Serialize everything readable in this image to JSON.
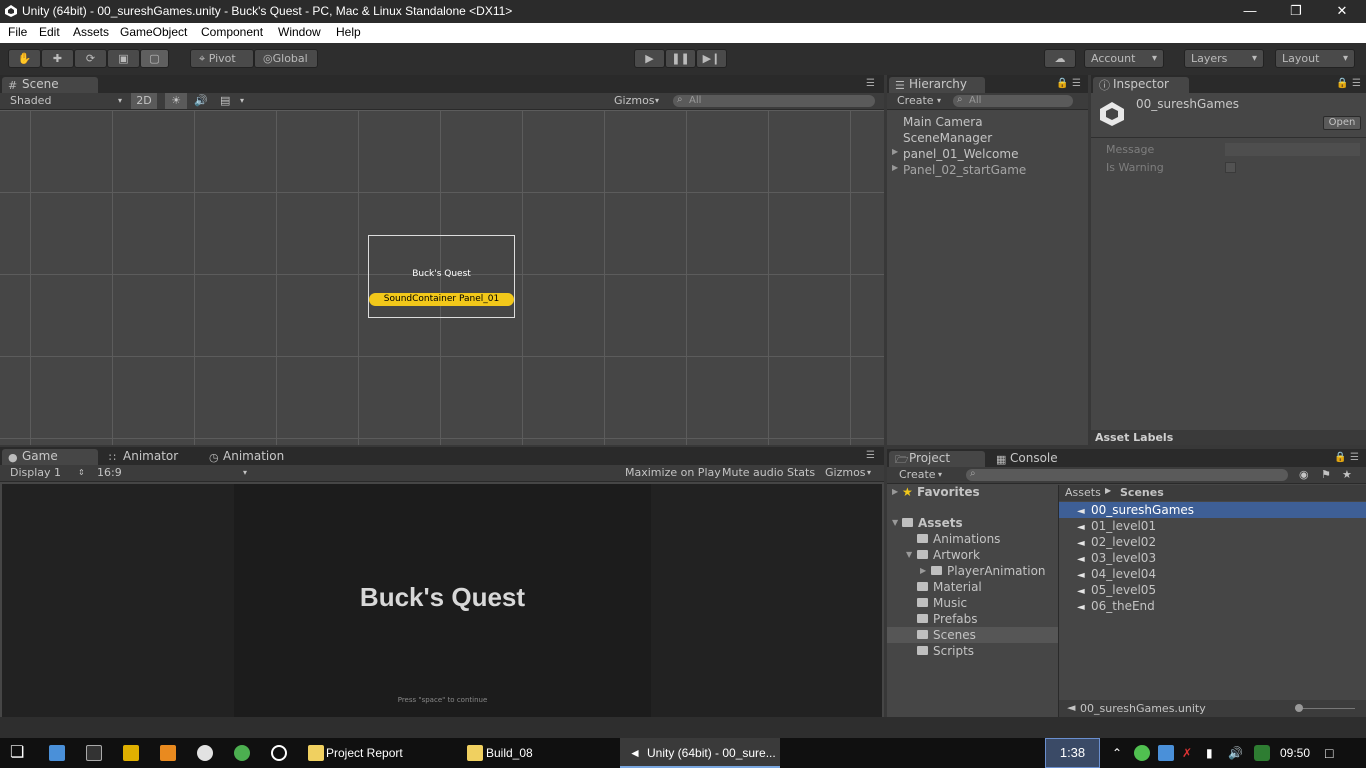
{
  "window": {
    "title": "Unity (64bit) - 00_sureshGames.unity - Buck's Quest - PC, Mac & Linux Standalone <DX11>"
  },
  "menu": [
    "File",
    "Edit",
    "Assets",
    "GameObject",
    "Component",
    "Window",
    "Help"
  ],
  "toolbar": {
    "pivot": "Pivot",
    "global": "Global",
    "account": "Account",
    "layers": "Layers",
    "layout": "Layout"
  },
  "scene": {
    "tab": "Scene",
    "shading": "Shaded",
    "mode2d": "2D",
    "gizmos": "Gizmos",
    "search_placeholder": "All",
    "canvas_title": "Buck's Quest",
    "selected_label": "SoundContainer Panel_01"
  },
  "game": {
    "tabs": [
      "Game",
      "Animator",
      "Animation"
    ],
    "display": "Display 1",
    "aspect": "16:9",
    "maximize": "Maximize on Play",
    "mute": "Mute audio",
    "stats": "Stats",
    "gizmos": "Gizmos",
    "title": "Buck's Quest",
    "hint": "Press \"space\" to continue"
  },
  "hierarchy": {
    "tab": "Hierarchy",
    "create": "Create",
    "search_placeholder": "All",
    "items": [
      "Main Camera",
      "SceneManager",
      "panel_01_Welcome",
      "Panel_02_startGame"
    ]
  },
  "inspector": {
    "tab": "Inspector",
    "object_name": "00_sureshGames",
    "open": "Open",
    "fields": [
      "Message",
      "Is Warning"
    ],
    "asset_labels": "Asset Labels"
  },
  "project": {
    "tabs": [
      "Project",
      "Console"
    ],
    "create": "Create",
    "favorites": "Favorites",
    "assets": "Assets",
    "folders": [
      "Animations",
      "Artwork",
      "PlayerAnimation",
      "Material",
      "Music",
      "Prefabs",
      "Scenes",
      "Scripts"
    ],
    "breadcrumb": [
      "Assets",
      "Scenes"
    ],
    "scenes": [
      "00_sureshGames",
      "01_level01",
      "02_level02",
      "03_level03",
      "04_level04",
      "05_level05",
      "06_theEnd"
    ],
    "footer": "00_sureshGames.unity"
  },
  "taskbar": {
    "apps": [
      "Project Report",
      "Build_08",
      "Unity (64bit) - 00_sure..."
    ],
    "timer": "1:38",
    "clock": "09:50"
  },
  "colors": {
    "selection": "#3e5f96",
    "label_yellow": "#f2c81a"
  }
}
